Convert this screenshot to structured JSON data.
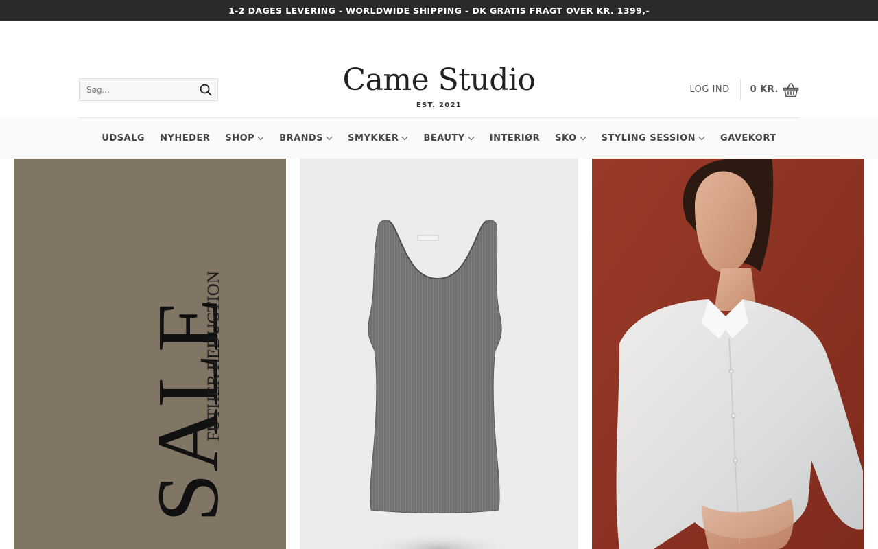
{
  "announcement": "1-2 DAGES LEVERING - WORLDWIDE SHIPPING - DK GRATIS FRAGT OVER KR. 1399,-",
  "search": {
    "placeholder": "Søg..."
  },
  "logo": {
    "name": "Came Studio",
    "est": "EST. 2021"
  },
  "account": {
    "login": "LOG IND",
    "cart_total": "0 KR."
  },
  "nav": [
    {
      "label": "UDSALG",
      "dropdown": false
    },
    {
      "label": "NYHEDER",
      "dropdown": false
    },
    {
      "label": "SHOP",
      "dropdown": true
    },
    {
      "label": "BRANDS",
      "dropdown": true
    },
    {
      "label": "SMYKKER",
      "dropdown": true
    },
    {
      "label": "BEAUTY",
      "dropdown": true
    },
    {
      "label": "INTERIØR",
      "dropdown": false
    },
    {
      "label": "SKO",
      "dropdown": true
    },
    {
      "label": "STYLING SESSION",
      "dropdown": true
    },
    {
      "label": "GAVEKORT",
      "dropdown": false
    }
  ],
  "banners": [
    {
      "word": "SALE",
      "sub": "FUTHER REDUCTION"
    },
    {
      "icon": "tank-top-product-image"
    },
    {
      "icon": "model-white-shirt-image"
    }
  ],
  "colors": {
    "topbar": "#2a2a2a",
    "sale_bg": "#817565",
    "product_bg": "#ececec",
    "model_bg": "#8e3222"
  }
}
